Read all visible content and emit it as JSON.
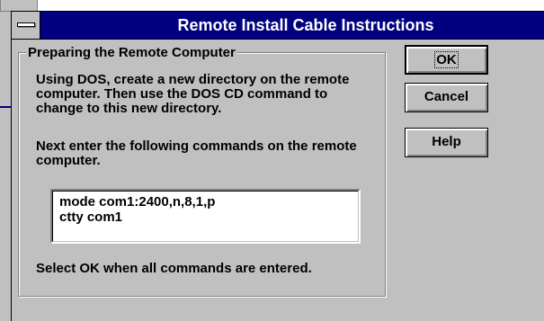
{
  "dialog": {
    "title": "Remote Install Cable Instructions",
    "group_label": "Preparing the Remote Computer",
    "paragraph1": "Using DOS, create a new directory on the remote computer.  Then use the DOS CD command to change to this new directory.",
    "paragraph2": "Next enter the following commands on the remote computer.",
    "commands": [
      "mode com1:2400,n,8,1,p",
      "ctty com1"
    ],
    "footer": "Select OK when all commands are entered."
  },
  "buttons": {
    "ok": "OK",
    "cancel": "Cancel",
    "help": "Help"
  },
  "icons": {
    "system_menu": "system-menu-icon"
  },
  "colors": {
    "title_bar": "#000080",
    "dialog_face": "#c0c0c0"
  }
}
